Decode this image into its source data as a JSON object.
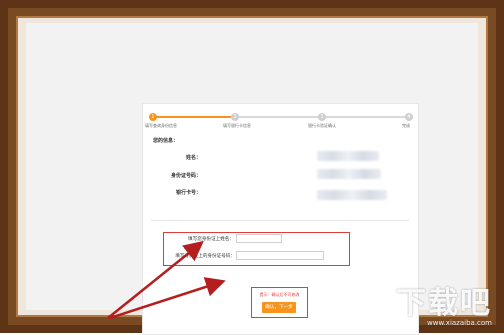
{
  "steps": [
    {
      "num": "1",
      "label": "填写查询身份信息"
    },
    {
      "num": "2",
      "label": "填写银行卡信息"
    },
    {
      "num": "3",
      "label": "银行卡验证确认"
    },
    {
      "num": "4",
      "label": "完成"
    }
  ],
  "info": {
    "title": "您的信息：",
    "rows": [
      {
        "label": "姓名："
      },
      {
        "label": "身份证号码："
      },
      {
        "label": "银行卡号："
      }
    ]
  },
  "form": {
    "name_label": "填写您身份证上姓名：",
    "name_value": "",
    "id_label": "填写身份证上的身份证号码：",
    "id_value": ""
  },
  "submit": {
    "tip": "提示：确认后不可修改",
    "button": "确认，下一步"
  },
  "colors": {
    "accent": "#f7941d",
    "highlight": "#e23b3b",
    "frame": "#7a4a22",
    "arrow": "#b51e1e"
  },
  "watermark": {
    "big": "下载吧",
    "small": "www.xiazaiba.com"
  }
}
